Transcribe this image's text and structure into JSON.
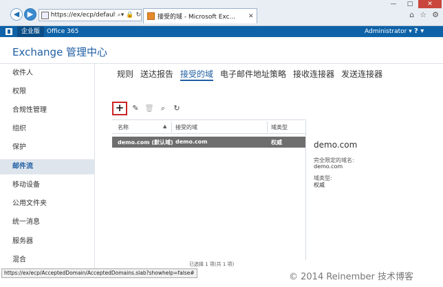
{
  "browser": {
    "address_url": "https://ex/ecp/default.a",
    "tab_title": "接受的域 - Microsoft Exc...",
    "status_url": "https://ex/ecp/AcceptedDomain/AcceptedDomains.slab?showhelp=false#"
  },
  "appbar": {
    "tab_enterprise": "企业版",
    "tab_o365": "Office 365",
    "admin_label": "Administrator ▾",
    "help_label": "? ▾"
  },
  "app_title": "Exchange 管理中心",
  "leftnav": {
    "items": [
      "收件人",
      "权限",
      "合规性管理",
      "组织",
      "保护",
      "邮件流",
      "移动设备",
      "公用文件夹",
      "统一消息",
      "服务器",
      "混合"
    ],
    "active_index": 5
  },
  "subtabs": [
    "规则",
    "送达报告",
    "接受的域",
    "电子邮件地址策略",
    "接收连接器",
    "发送连接器"
  ],
  "subtabs_active_index": 2,
  "grid": {
    "headers": [
      "名称",
      "接受的域",
      "域类型"
    ],
    "rows": [
      {
        "name": "demo.com (默认域)",
        "domain": "demo.com",
        "type": "权威"
      }
    ],
    "status": "已选择 1 项(共 1 项)"
  },
  "details": {
    "title": "demo.com",
    "fqdn_label": "完全限定的域名:",
    "fqdn_value": "demo.com",
    "type_label": "域类型:",
    "type_value": "权威"
  },
  "watermark": "© 2014 Reinember 技术博客",
  "icons": {
    "add": "add-icon",
    "edit": "edit-icon",
    "delete": "delete-icon",
    "search": "search-icon",
    "refresh": "refresh-icon"
  }
}
